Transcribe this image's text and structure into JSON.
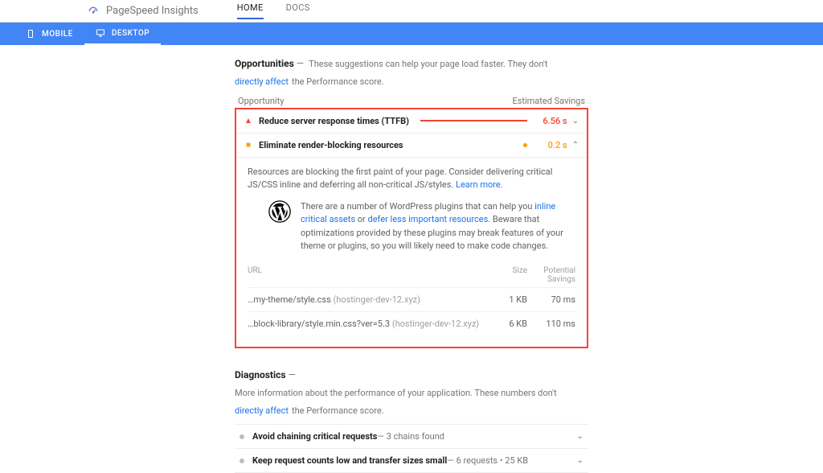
{
  "app": {
    "title": "PageSpeed Insights"
  },
  "top_tabs": {
    "home": "HOME",
    "docs": "DOCS"
  },
  "device_tabs": {
    "mobile": "MOBILE",
    "desktop": "DESKTOP"
  },
  "opportunities": {
    "title": "Opportunities",
    "desc_prefix": "These suggestions can help your page load faster. They don't",
    "desc_link": "directly affect",
    "desc_suffix": "the Performance score.",
    "col_left": "Opportunity",
    "col_right": "Estimated Savings",
    "items": [
      {
        "label": "Reduce server response times (TTFB)",
        "savings": "6.56 s",
        "severity": "red",
        "bar_pct": 100,
        "chev": "⌄"
      },
      {
        "label": "Eliminate render-blocking resources",
        "savings": "0.2 s",
        "severity": "orange",
        "bar_pct": 3,
        "chev": "⌃"
      }
    ],
    "detail": {
      "desc": "Resources are blocking the first paint of your page. Consider delivering critical JS/CSS inline and deferring all non-critical JS/styles.",
      "learn_more": "Learn more",
      "wp_prefix": "There are a number of WordPress plugins that can help you",
      "wp_link1": "inline critical assets",
      "wp_or": "or",
      "wp_link2": "defer less important resources",
      "wp_suffix": ". Beware that optimizations provided by these plugins may break features of your theme or plugins, so you will likely need to make code changes.",
      "cols": {
        "url": "URL",
        "size": "Size",
        "savings": "Potential Savings"
      },
      "resources": [
        {
          "path": "…my-theme/style.css",
          "host": "(hostinger-dev-12.xyz)",
          "size": "1 KB",
          "savings": "70 ms"
        },
        {
          "path": "…block-library/style.min.css?ver=5.3",
          "host": "(hostinger-dev-12.xyz)",
          "size": "6 KB",
          "savings": "110 ms"
        }
      ]
    }
  },
  "diagnostics": {
    "title": "Diagnostics",
    "desc_prefix": "More information about the performance of your application. These numbers don't",
    "desc_link": "directly affect",
    "desc_suffix": "the Performance score.",
    "items": [
      {
        "title": "Avoid chaining critical requests",
        "sub": "3 chains found"
      },
      {
        "title": "Keep request counts low and transfer sizes small",
        "sub": "6 requests • 25 KB"
      }
    ]
  }
}
